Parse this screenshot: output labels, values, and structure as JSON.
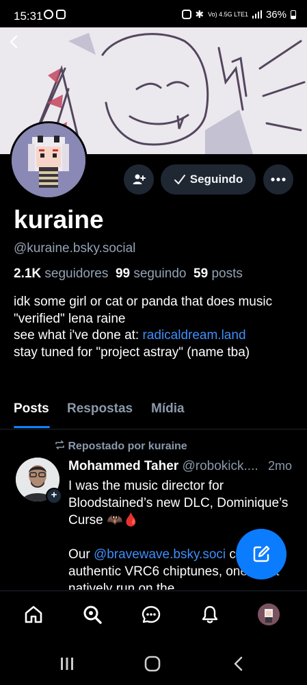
{
  "status_bar": {
    "time": "15:31",
    "network": "Vo) 4.5G LTE1",
    "battery": "36%"
  },
  "profile": {
    "name": "kuraine",
    "handle": "@kuraine.bsky.social",
    "stats": {
      "followers_count": "2.1K",
      "followers_label": "seguidores",
      "following_count": "99",
      "following_label": "seguindo",
      "posts_count": "59",
      "posts_label": "posts"
    },
    "bio": {
      "line1": "idk some girl or cat or panda that does music",
      "line2": "\"verified\" lena raine",
      "line3_prefix": "see what i've done at: ",
      "line3_link": "radicaldream.land",
      "line4": "stay tuned for \"project astray\" (name tba)"
    },
    "following_button_label": "Seguindo"
  },
  "tabs": [
    {
      "label": "Posts",
      "active": true
    },
    {
      "label": "Respostas",
      "active": false
    },
    {
      "label": "Mídia",
      "active": false
    }
  ],
  "post": {
    "repost_label": "Repostado por kuraine",
    "author_name": "Mohammed Taher",
    "author_handle": "@robokick....",
    "time": "2mo",
    "text_line1": "I was the music director for Bloodstained’s new DLC, Dominique’s Curse 🦇🩸",
    "text_line2_prefix": "Our ",
    "text_line2_link": "@bravewave.bsky.soci",
    "text_line2_suffix": "created authentic VRC6 chiptunes, ones that natively run on the"
  },
  "colors": {
    "accent": "#1083fe",
    "link": "#3e8ffa",
    "muted": "#8b9aab",
    "button_bg": "#1f2733"
  },
  "icons": {
    "back": "chevron-left-icon",
    "follow": "person-plus-icon",
    "check": "check-icon",
    "more": "ellipsis-icon",
    "repost": "repost-icon",
    "compose": "compose-icon",
    "home": "home-icon",
    "search": "search-icon",
    "chat": "chat-icon",
    "notifications": "bell-icon"
  }
}
